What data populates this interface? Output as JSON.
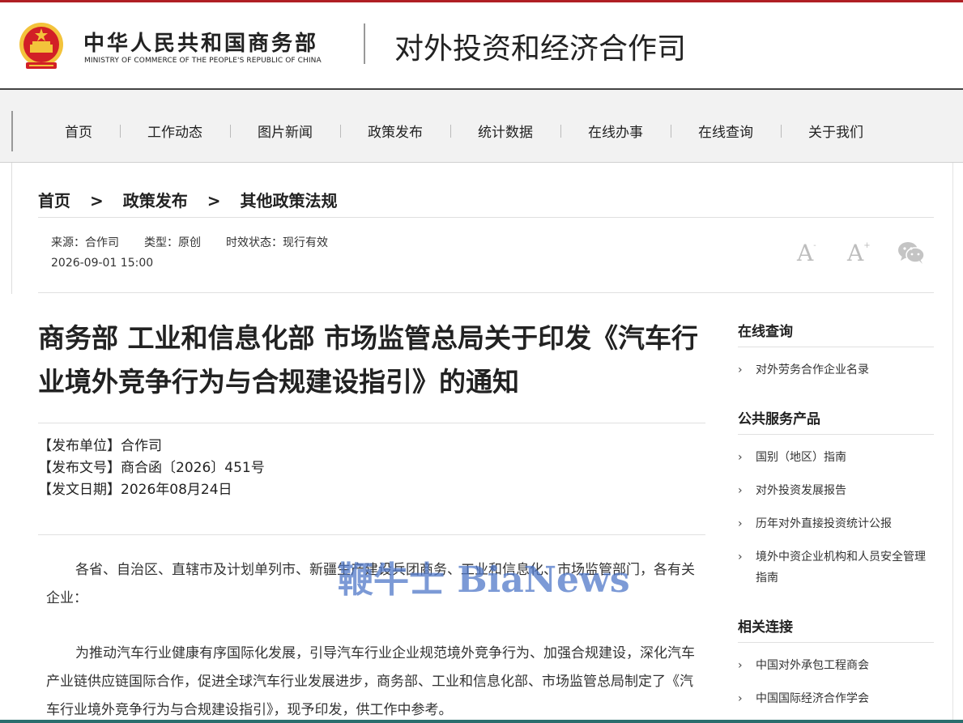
{
  "header": {
    "ministry_cn": "中华人民共和国商务部",
    "ministry_en": "MINISTRY OF COMMERCE OF THE PEOPLE'S REPUBLIC OF CHINA",
    "department": "对外投资和经济合作司",
    "emblem_icon": "national-emblem"
  },
  "nav": {
    "items": [
      "首页",
      "工作动态",
      "图片新闻",
      "政策发布",
      "统计数据",
      "在线办事",
      "在线查询",
      "关于我们"
    ]
  },
  "breadcrumb": {
    "items": [
      "首页",
      "政策发布",
      "其他政策法规"
    ],
    "separator": ">"
  },
  "meta": {
    "source": "来源：合作司",
    "type": "类型：原创",
    "status": "时效状态：现行有效",
    "datetime": "2026-09-01 15:00",
    "font_decrease": "A",
    "font_decrease_mark": "-",
    "font_increase": "A",
    "font_increase_mark": "+",
    "share_icon": "wechat-icon"
  },
  "article": {
    "title": "商务部 工业和信息化部 市场监管总局关于印发《汽车行业境外竞争行为与合规建设指引》的通知",
    "pub_unit": "【发布单位】合作司",
    "doc_number": "【发布文号】商合函〔2026〕451号",
    "pub_date": "【发文日期】2026年08月24日",
    "paragraphs": [
      "各省、自治区、直辖市及计划单列市、新疆生产建设兵团商务、工业和信息化、市场监管部门，各有关企业：",
      "为推动汽车行业健康有序国际化发展，引导汽车行业企业规范境外竞争行为、加强合规建设，深化汽车产业链供应链国际合作，促进全球汽车行业发展进步，商务部、工业和信息化部、市场监管总局制定了《汽车行业境外竞争行为与合规建设指引》，现予印发，供工作中参考。"
    ]
  },
  "watermark": "鞭牛士 BiaNews",
  "sidebar": {
    "sections": [
      {
        "title": "在线查询",
        "items": [
          "对外劳务合作企业名录"
        ]
      },
      {
        "title": "公共服务产品",
        "items": [
          "国别（地区）指南",
          "对外投资发展报告",
          "历年对外直接投资统计公报",
          "境外中资企业机构和人员安全管理指南"
        ]
      },
      {
        "title": "相关连接",
        "items": [
          "中国对外承包工程商会",
          "中国国际经济合作学会"
        ]
      }
    ],
    "chevron": "›"
  },
  "colors": {
    "accent_red": "#b01f24",
    "emblem_gold": "#f3c33b",
    "watermark_blue": "#5078c8"
  }
}
